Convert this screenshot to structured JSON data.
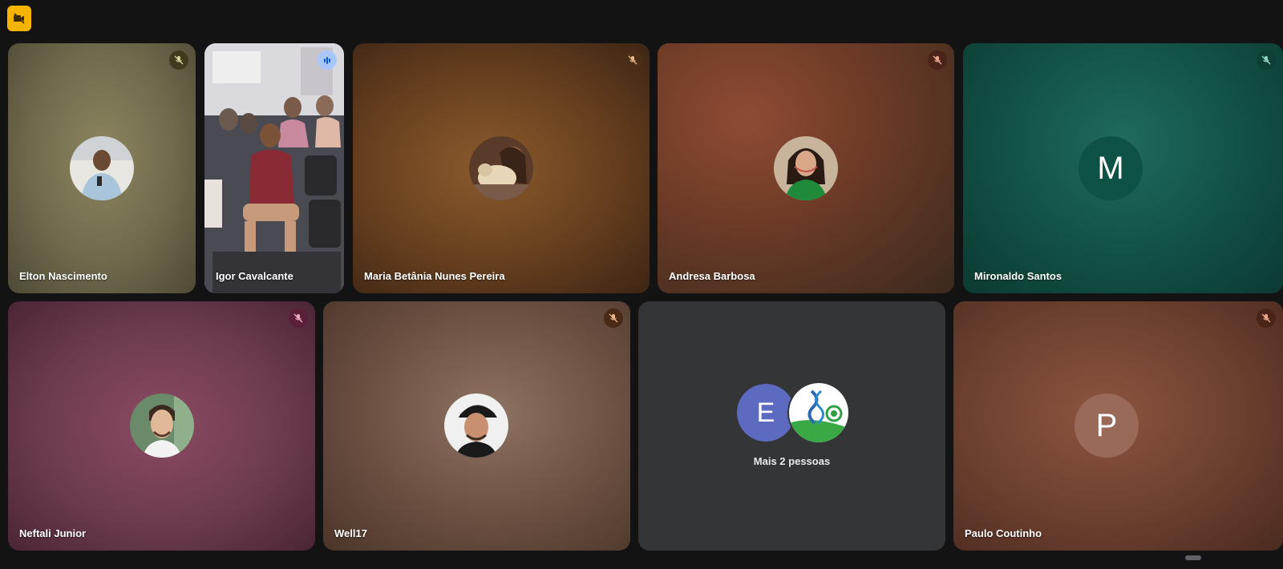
{
  "toolbar": {
    "camera_badge_icon": "camera-off-icon",
    "badge_color": "#f4b400"
  },
  "participants": [
    {
      "name": "Elton Nascimento",
      "muted": true,
      "avatar": "photo"
    },
    {
      "name": "Igor Cavalcante",
      "muted": false,
      "speaking": true,
      "video": true
    },
    {
      "name": "Maria Betânia Nunes Pereira",
      "muted": true,
      "avatar": "photo"
    },
    {
      "name": "Andresa Barbosa",
      "muted": true,
      "avatar": "photo"
    },
    {
      "name": "Mironaldo Santos",
      "muted": true,
      "initial": "M",
      "initial_color": "#0e5245"
    },
    {
      "name": "Neftali Junior",
      "muted": true,
      "avatar": "photo"
    },
    {
      "name": "Well17",
      "muted": true,
      "avatar": "photo"
    },
    {
      "name": "Paulo Coutinho",
      "muted": true,
      "initial": "P",
      "initial_color": "#9a6a58"
    }
  ],
  "more_people": {
    "label": "Mais 2 pessoas",
    "initial": "E",
    "initial_color": "#5c6bc0"
  },
  "colors": {
    "speaking_border": "#a8c7fa",
    "background": "#131314"
  }
}
